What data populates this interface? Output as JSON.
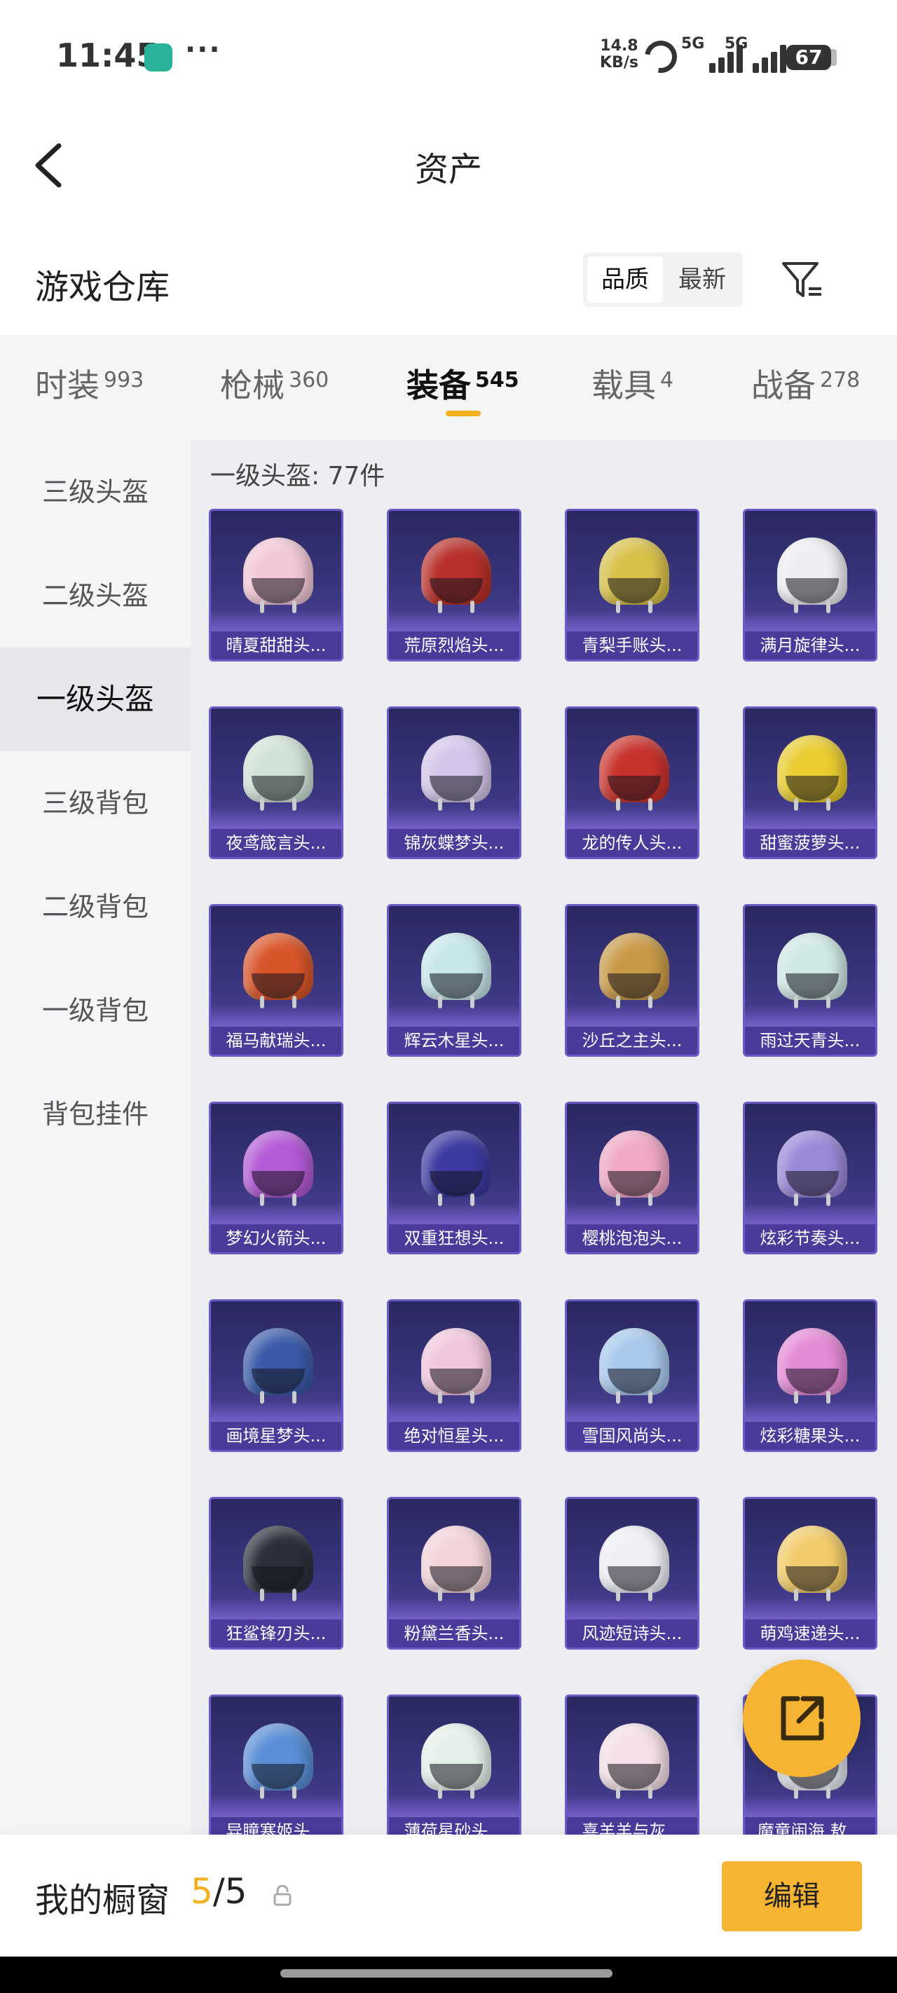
{
  "status": {
    "time": "11:45",
    "dots": "···",
    "net_speed_value": "14.8",
    "net_speed_unit": "KB/s",
    "sim1": "5G",
    "sim2": "5G",
    "battery": "67"
  },
  "header": {
    "title": "资产"
  },
  "section": {
    "title": "游戏仓库",
    "sort_options": [
      "品质",
      "最新"
    ],
    "selected_sort": "品质"
  },
  "tabs": [
    {
      "label": "时装",
      "count": "993"
    },
    {
      "label": "枪械",
      "count": "360"
    },
    {
      "label": "装备",
      "count": "545"
    },
    {
      "label": "载具",
      "count": "4"
    },
    {
      "label": "战备",
      "count": "278"
    }
  ],
  "active_tab": "装备",
  "sidebar": {
    "items": [
      "三级头盔",
      "二级头盔",
      "一级头盔",
      "三级背包",
      "二级背包",
      "一级背包",
      "背包挂件"
    ],
    "active": "一级头盔"
  },
  "content": {
    "count_label": "一级头盔: 77件"
  },
  "items": [
    {
      "name": "晴夏甜甜头...",
      "color": "#f2c7d6"
    },
    {
      "name": "荒原烈焰头...",
      "color": "#b8302a"
    },
    {
      "name": "青梨手账头...",
      "color": "#d8c04a"
    },
    {
      "name": "满月旋律头...",
      "color": "#eeeef2"
    },
    {
      "name": "夜鸢箴言头...",
      "color": "#cfe3d6"
    },
    {
      "name": "锦灰蝶梦头...",
      "color": "#d4c6ea"
    },
    {
      "name": "龙的传人头...",
      "color": "#c8322c"
    },
    {
      "name": "甜蜜菠萝头...",
      "color": "#e8cc30"
    },
    {
      "name": "福马献瑞头...",
      "color": "#d8552a"
    },
    {
      "name": "辉云木星头...",
      "color": "#c6e6ea"
    },
    {
      "name": "沙丘之主头...",
      "color": "#c89a48"
    },
    {
      "name": "雨过天青头...",
      "color": "#cfe8e4"
    },
    {
      "name": "梦幻火箭头...",
      "color": "#b35ad6"
    },
    {
      "name": "双重狂想头...",
      "color": "#3a3aa0"
    },
    {
      "name": "樱桃泡泡头...",
      "color": "#f0a8c4"
    },
    {
      "name": "炫彩节奏头...",
      "color": "#9a88d8"
    },
    {
      "name": "画境星梦头...",
      "color": "#3a5aa8"
    },
    {
      "name": "绝对恒星头...",
      "color": "#f0c6dc"
    },
    {
      "name": "雪国风尚头...",
      "color": "#a8c8ec"
    },
    {
      "name": "炫彩糖果头...",
      "color": "#e48ad6"
    },
    {
      "name": "狂鲨锋刃头...",
      "color": "#2a2f3a"
    },
    {
      "name": "粉黛兰香头...",
      "color": "#f2d4da"
    },
    {
      "name": "风迹短诗头...",
      "color": "#eef0f6"
    },
    {
      "name": "萌鸡速递头...",
      "color": "#f2cc6a"
    },
    {
      "name": "异瞳寒姬头...",
      "color": "#5a8ed6"
    },
    {
      "name": "薄荷星砂头...",
      "color": "#e6f0ea"
    },
    {
      "name": "喜羊羊与灰...",
      "color": "#f4e0e6"
    },
    {
      "name": "魔童闹海 敖...",
      "color": "#eaeef4"
    }
  ],
  "showcase": {
    "label": "我的橱窗",
    "current": "5",
    "total": "5"
  },
  "bottom": {
    "edit_label": "编辑"
  },
  "colors": {
    "accent": "#f5b533",
    "card_bg": "#2e2c6a",
    "card_label_bg": "#4a3a9a"
  },
  "icons": {
    "back": "back-chevron-icon",
    "filter": "filter-icon",
    "share": "share-external-icon",
    "lock": "lock-icon"
  }
}
